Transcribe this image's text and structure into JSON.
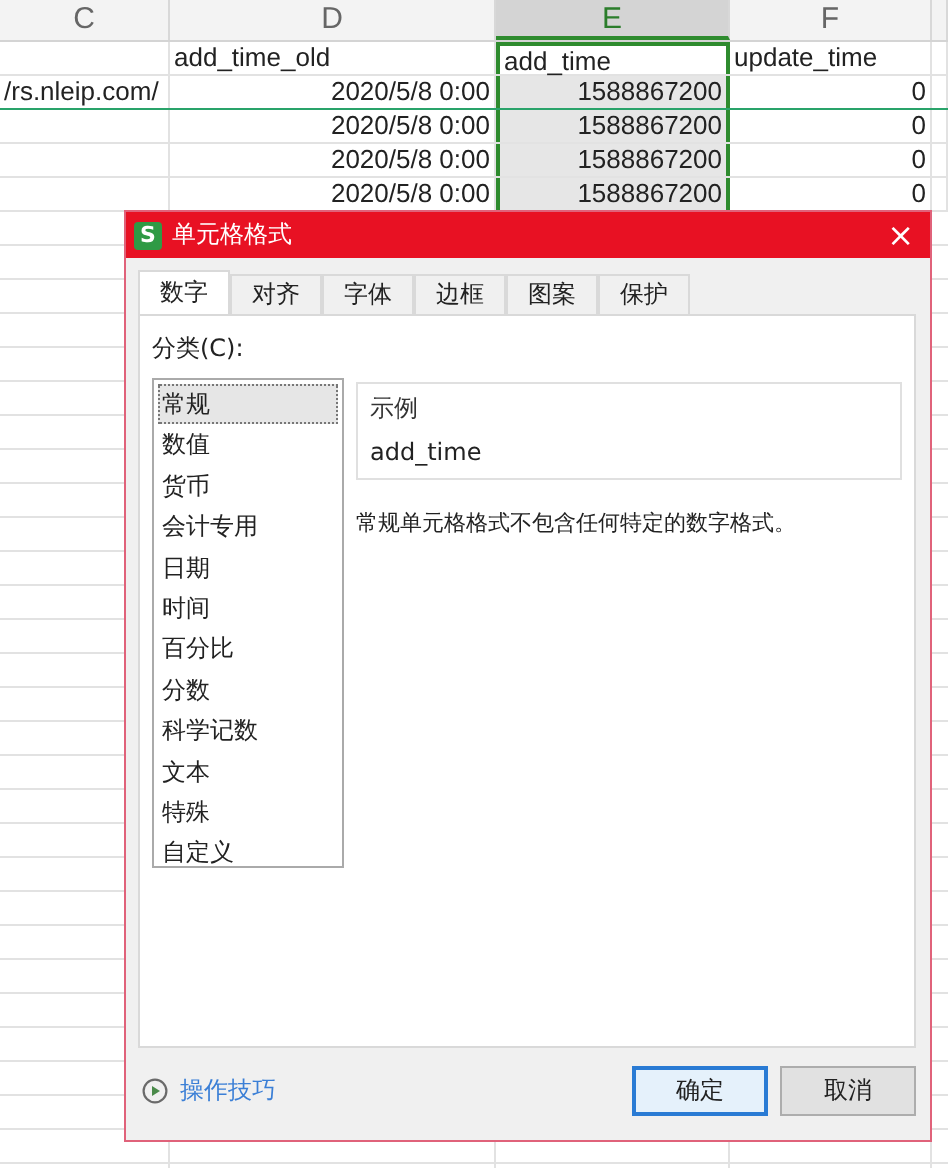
{
  "sheet": {
    "columns": [
      {
        "letter": "C",
        "selected": false
      },
      {
        "letter": "D",
        "selected": false
      },
      {
        "letter": "E",
        "selected": true
      },
      {
        "letter": "F",
        "selected": false
      }
    ],
    "rows": [
      [
        "",
        "add_time_old",
        "add_time",
        "update_time"
      ],
      [
        "/rs.nleip.com/",
        "2020/5/8 0:00",
        "1588867200",
        "0"
      ],
      [
        "",
        "2020/5/8 0:00",
        "1588867200",
        "0"
      ],
      [
        "",
        "2020/5/8 0:00",
        "1588867200",
        "0"
      ],
      [
        "",
        "2020/5/8 0:00",
        "1588867200",
        "0"
      ]
    ]
  },
  "dialog": {
    "app_icon": "S",
    "title": "单元格格式",
    "close": "×",
    "tabs": [
      {
        "label": "数字",
        "selected": true
      },
      {
        "label": "对齐",
        "selected": false
      },
      {
        "label": "字体",
        "selected": false
      },
      {
        "label": "边框",
        "selected": false
      },
      {
        "label": "图案",
        "selected": false
      },
      {
        "label": "保护",
        "selected": false
      }
    ],
    "category_label": "分类(C):",
    "categories": [
      {
        "label": "常规",
        "selected": true
      },
      {
        "label": "数值",
        "selected": false
      },
      {
        "label": "货币",
        "selected": false
      },
      {
        "label": "会计专用",
        "selected": false
      },
      {
        "label": "日期",
        "selected": false
      },
      {
        "label": "时间",
        "selected": false
      },
      {
        "label": "百分比",
        "selected": false
      },
      {
        "label": "分数",
        "selected": false
      },
      {
        "label": "科学记数",
        "selected": false
      },
      {
        "label": "文本",
        "selected": false
      },
      {
        "label": "特殊",
        "selected": false
      },
      {
        "label": "自定义",
        "selected": false
      }
    ],
    "sample_label": "示例",
    "sample_value": "add_time",
    "description": "常规单元格格式不包含任何特定的数字格式。",
    "tips_link": "操作技巧",
    "buttons": [
      {
        "label": "确定",
        "kind": "primary"
      },
      {
        "label": "取消",
        "kind": "normal"
      }
    ]
  }
}
